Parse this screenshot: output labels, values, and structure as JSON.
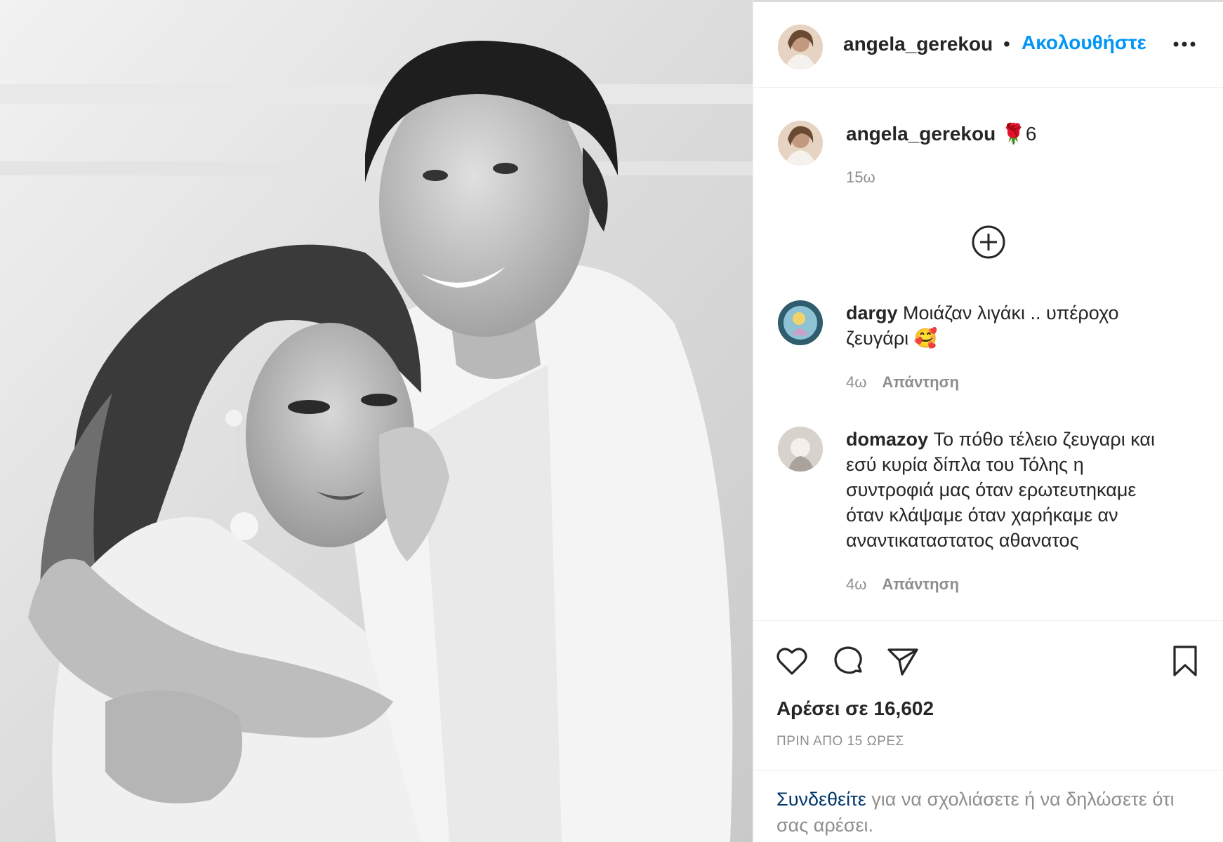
{
  "post": {
    "username": "angela_gerekou",
    "follow_label": "Ακολουθήστε",
    "separator": "•",
    "caption_emoji": "🌹",
    "caption_text": "6",
    "caption_time": "15ω"
  },
  "comments": [
    {
      "username": "dargy",
      "text": "Μοιάζαν λιγάκι .. υπέροχο ζευγάρι 🥰",
      "time": "4ω",
      "reply_label": "Απάντηση"
    },
    {
      "username": "domazoy",
      "text": "Το πόθο τέλειο ζευγαρι και εσύ κυρία δίπλα του Τόλης η συντροφιά μας όταν ερωτευτηκαμε όταν κλάψαμε όταν χαρήκαμε αν αναντικαταστατος αθανατος",
      "time": "4ω",
      "reply_label": "Απάντηση"
    }
  ],
  "stats": {
    "likes_text": "Αρέσει σε 16,602",
    "posted_ago": "ΠΡΙΝ ΑΠΟ 15 ΩΡΕΣ"
  },
  "login_prompt": {
    "link_text": "Συνδεθείτε",
    "rest_text": " για να σχολιάσετε ή να δηλώσετε ότι σας αρέσει."
  },
  "icons": {
    "more": "more-horizontal-icon",
    "load_more": "plus-circle-icon",
    "like": "heart-icon",
    "comment": "comment-icon",
    "share": "share-icon",
    "save": "bookmark-icon"
  },
  "colors": {
    "accent": "#0095f6",
    "text": "#262626",
    "muted": "#8e8e8e",
    "link": "#00376b"
  }
}
